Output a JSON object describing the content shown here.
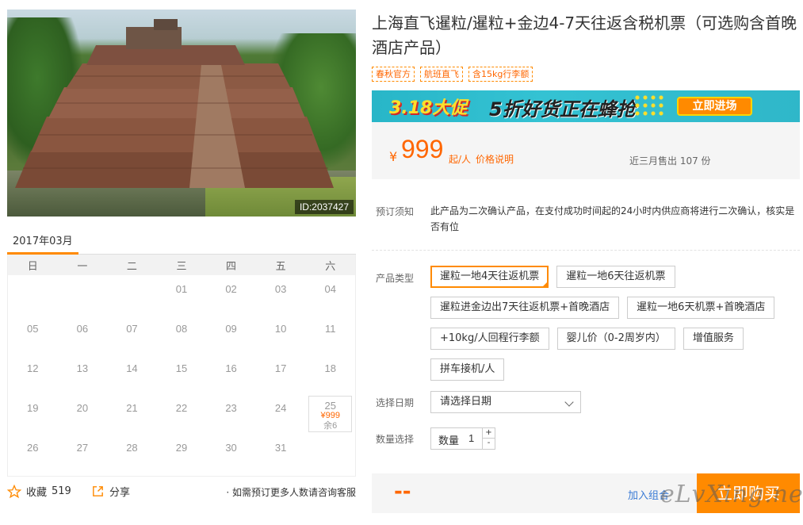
{
  "photo": {
    "id_label": "ID:2037427"
  },
  "calendar": {
    "month": "2017年03月",
    "weekdays": [
      "日",
      "一",
      "二",
      "三",
      "四",
      "五",
      "六"
    ],
    "rows": [
      [
        "",
        "",
        "",
        "01",
        "02",
        "03",
        "04"
      ],
      [
        "05",
        "06",
        "07",
        "08",
        "09",
        "10",
        "11"
      ],
      [
        "12",
        "13",
        "14",
        "15",
        "16",
        "17",
        "18"
      ],
      [
        "19",
        "20",
        "21",
        "22",
        "23",
        "24",
        "25"
      ],
      [
        "26",
        "27",
        "28",
        "29",
        "30",
        "31",
        ""
      ]
    ],
    "available": {
      "day": "25",
      "price": "¥999",
      "stock": "余6"
    }
  },
  "bottom": {
    "fav_label": "收藏",
    "fav_count": "519",
    "share_label": "分享",
    "note": "· 如需预订更多人数请咨询客服"
  },
  "product": {
    "title": "上海直飞暹粒/暹粒+金边4-7天往返含税机票（可选购含首晚酒店产品）",
    "tags": [
      "春秋官方",
      "航班直飞",
      "含15kg行李额"
    ]
  },
  "banner": {
    "left_text": "3.18大促",
    "mid_text": "5折好货正在蜂抢",
    "button": "立即进场"
  },
  "price": {
    "currency": "¥",
    "amount": "999",
    "unit": "起/人",
    "explain": "价格说明",
    "sold": "近三月售出 107 份"
  },
  "notice": {
    "label": "预订须知",
    "text": "此产品为二次确认产品，在支付成功时间起的24小时内供应商将进行二次确认，核实是否有位"
  },
  "product_type": {
    "label": "产品类型",
    "options": [
      "暹粒一地4天往返机票",
      "暹粒一地6天往返机票",
      "暹粒进金边出7天往返机票+首晚酒店",
      "暹粒一地6天机票+首晚酒店",
      "+10kg/人回程行李额",
      "婴儿价（0-2周岁内）",
      "增值服务",
      "拼车接机/人"
    ],
    "selected_index": 0
  },
  "date": {
    "label": "选择日期",
    "placeholder": "请选择日期"
  },
  "quantity": {
    "label": "数量选择",
    "field_label": "数量",
    "value": "1",
    "plus": "+",
    "minus": "-"
  },
  "buy": {
    "total": "--",
    "add_combo": "加入组合",
    "buy_now": "立即购买"
  },
  "watermark": "eLvXing.net",
  "colors": {
    "accent": "#ff8a00",
    "price": "#ff6600",
    "link": "#3a7bd5",
    "banner": "#2fb7c9"
  }
}
